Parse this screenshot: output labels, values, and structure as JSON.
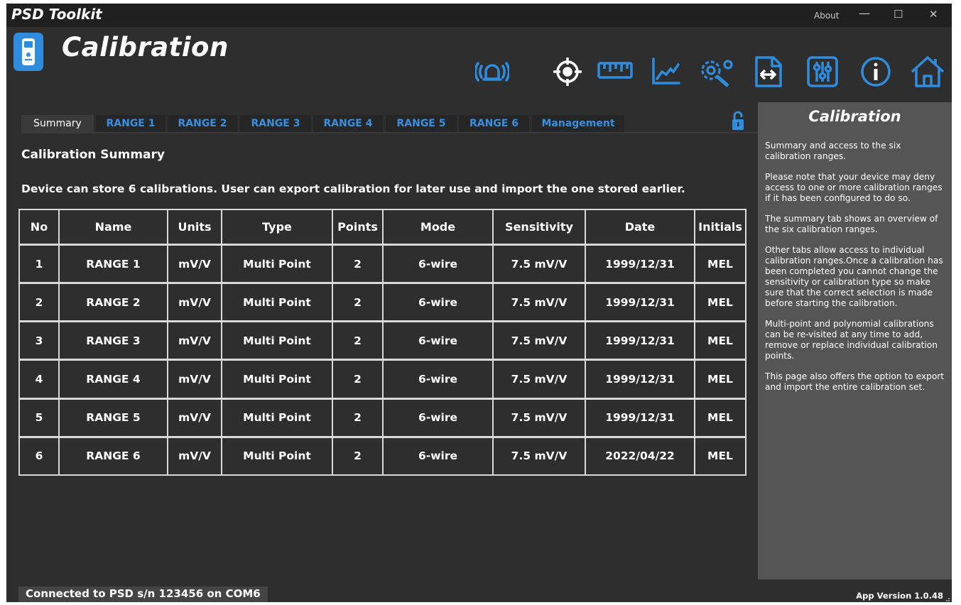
{
  "window": {
    "app_title": "PSD Toolkit",
    "about_label": "About",
    "minimize_glyph": "—",
    "maximize_glyph": "☐",
    "close_glyph": "✕"
  },
  "header": {
    "page_title": "Calibration",
    "page_icon": "handheld-device-icon",
    "toolbar_icons": [
      "alarm-icon",
      "target-icon",
      "ruler-icon",
      "chart-icon",
      "settings-icon",
      "transfer-icon",
      "sliders-icon",
      "info-icon",
      "home-icon"
    ]
  },
  "tabs": [
    {
      "label": "Summary"
    },
    {
      "label": "RANGE 1"
    },
    {
      "label": "RANGE 2"
    },
    {
      "label": "RANGE 3"
    },
    {
      "label": "RANGE 4"
    },
    {
      "label": "RANGE 5"
    },
    {
      "label": "RANGE 6"
    },
    {
      "label": "Management"
    }
  ],
  "main": {
    "section_title": "Calibration Summary",
    "description": "Device can store 6 calibrations. User can export calibration for later use and import the one stored earlier.",
    "table": {
      "columns": [
        "No",
        "Name",
        "Units",
        "Type",
        "Points",
        "Mode",
        "Sensitivity",
        "Date",
        "Initials"
      ],
      "rows": [
        [
          "1",
          "RANGE 1",
          "mV/V",
          "Multi Point",
          "2",
          "6-wire",
          "7.5 mV/V",
          "1999/12/31",
          "MEL"
        ],
        [
          "2",
          "RANGE 2",
          "mV/V",
          "Multi Point",
          "2",
          "6-wire",
          "7.5 mV/V",
          "1999/12/31",
          "MEL"
        ],
        [
          "3",
          "RANGE 3",
          "mV/V",
          "Multi Point",
          "2",
          "6-wire",
          "7.5 mV/V",
          "1999/12/31",
          "MEL"
        ],
        [
          "4",
          "RANGE 4",
          "mV/V",
          "Multi Point",
          "2",
          "6-wire",
          "7.5 mV/V",
          "1999/12/31",
          "MEL"
        ],
        [
          "5",
          "RANGE 5",
          "mV/V",
          "Multi Point",
          "2",
          "6-wire",
          "7.5 mV/V",
          "1999/12/31",
          "MEL"
        ],
        [
          "6",
          "RANGE 6",
          "mV/V",
          "Multi Point",
          "2",
          "6-wire",
          "7.5 mV/V",
          "2022/04/22",
          "MEL"
        ]
      ]
    }
  },
  "help": {
    "title": "Calibration",
    "paragraphs": [
      "Summary and access to the six calibration ranges.",
      "Please note that your device may deny access to one or more calibration ranges if it has been configured to do so.",
      "The summary tab shows an overview of the six calibration ranges.",
      "Other tabs allow access to individual calibration ranges.Once a calibration has been completed you cannot change the sensitivity or calibration type so make sure that the correct selection is made before starting the calibration.",
      "Multi-point and polynomial calibrations can be re-visited at any time to add, remove or replace individual calibration points.",
      "This page also offers the option to export and import the entire calibration set."
    ]
  },
  "status": {
    "connection": "Connected to PSD s/n 123456 on COM6",
    "version": "App Version 1.0.48"
  },
  "colors": {
    "accent": "#2f8de0",
    "tab_inactive_text": "#3a8fe0",
    "lock": "#2f8de0",
    "background": "#2e2e2e",
    "panel": "#555555"
  }
}
